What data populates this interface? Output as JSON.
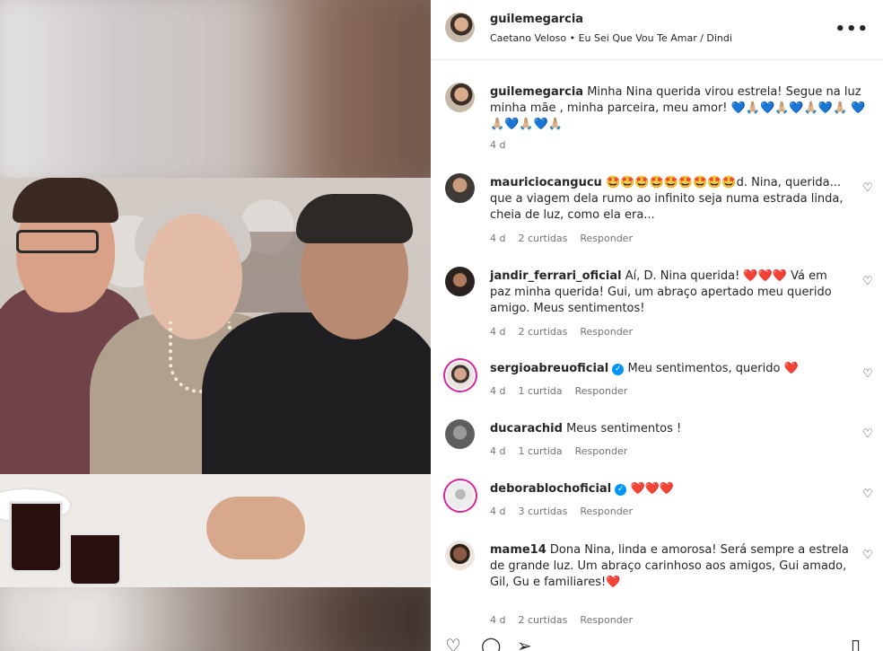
{
  "header": {
    "username": "guilemegarcia",
    "audio": "Caetano Veloso • Eu Sei Que Vou Te Amar / Dindi",
    "more_icon": "more-horizontal-icon"
  },
  "caption": {
    "username": "guilemegarcia",
    "text": "Minha Nina querida virou estrela! Segue na luz minha mãe , minha parceira, meu amor! 💙🙏🏼💙🙏🏼💙🙏🏼💙🙏🏼 💙🙏🏼💙🙏🏼💙🙏🏼",
    "time": "4 d"
  },
  "comments": [
    {
      "username": "mauriciocangucu",
      "verified": false,
      "text": "🤩🤩🤩🤩🤩🤩🤩🤩🤩d. Nina, querida... que a viagem dela rumo ao infinito seja numa estrada linda, cheia de luz, como ela era...",
      "time": "4 d",
      "likes": "2 curtidas",
      "reply": "Responder"
    },
    {
      "username": "jandir_ferrari_oficial",
      "verified": false,
      "text": "Aí, D. Nina querida! ❤️❤️❤️ Vá em paz minha querida! Gui, um abraço apertado meu querido amigo. Meus sentimentos!",
      "time": "4 d",
      "likes": "2 curtidas",
      "reply": "Responder"
    },
    {
      "username": "sergioabreuoficial",
      "verified": true,
      "text": "Meu sentimentos, querido ❤️",
      "time": "4 d",
      "likes": "1 curtida",
      "reply": "Responder"
    },
    {
      "username": "ducarachid",
      "verified": false,
      "text": "Meus sentimentos !",
      "time": "4 d",
      "likes": "1 curtida",
      "reply": "Responder"
    },
    {
      "username": "deborablochoficial",
      "verified": true,
      "text": "❤️❤️❤️",
      "time": "4 d",
      "likes": "3 curtidas",
      "reply": "Responder"
    },
    {
      "username": "mame14",
      "verified": false,
      "text": "Dona Nina, linda e amorosa! Será sempre a estrela de grande luz. Um abraço carinhoso aos amigos, Gui amado, Gil, Gu e familiares!❤️",
      "time": "4 d",
      "likes": "2 curtidas",
      "reply": "Responder"
    }
  ],
  "icons": {
    "like": "heart-icon",
    "comment": "comment-icon",
    "share": "share-icon",
    "save": "bookmark-icon"
  }
}
